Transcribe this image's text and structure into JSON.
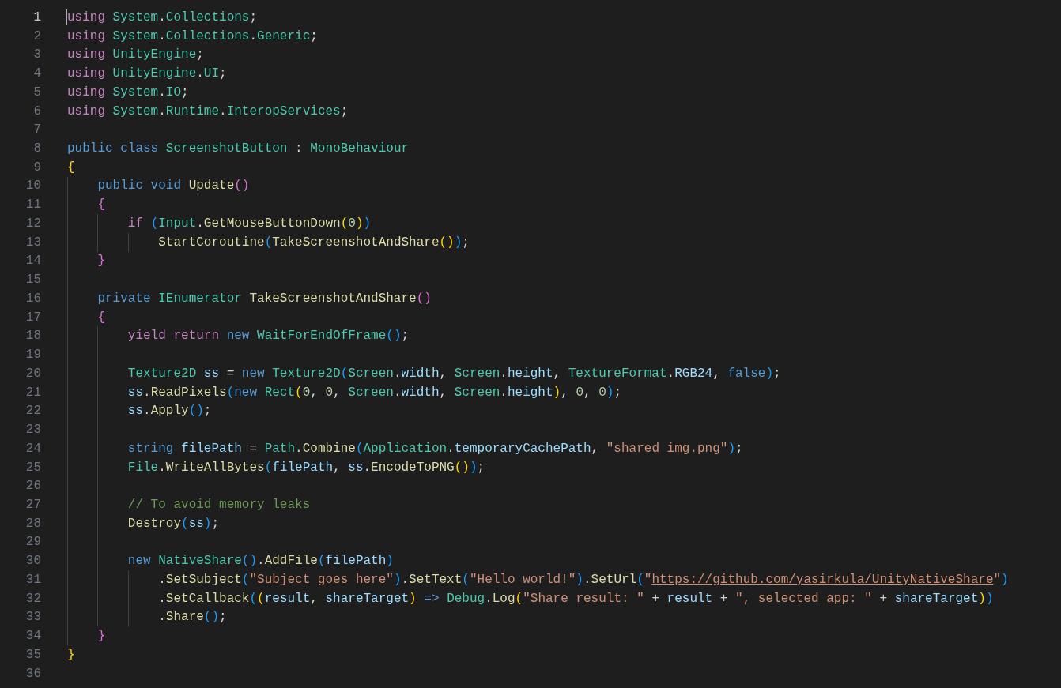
{
  "editor": {
    "lines": [
      {
        "number": "1",
        "active": true,
        "tokens": [
          {
            "kind": "ctl",
            "text": "using "
          },
          {
            "kind": "ty",
            "text": "System"
          },
          {
            "kind": "p",
            "text": "."
          },
          {
            "kind": "ty",
            "text": "Collections"
          },
          {
            "kind": "p",
            "text": ";"
          }
        ]
      },
      {
        "number": "2",
        "active": false,
        "tokens": [
          {
            "kind": "ctl",
            "text": "using "
          },
          {
            "kind": "ty",
            "text": "System"
          },
          {
            "kind": "p",
            "text": "."
          },
          {
            "kind": "ty",
            "text": "Collections"
          },
          {
            "kind": "p",
            "text": "."
          },
          {
            "kind": "ty",
            "text": "Generic"
          },
          {
            "kind": "p",
            "text": ";"
          }
        ]
      },
      {
        "number": "3",
        "active": false,
        "tokens": [
          {
            "kind": "ctl",
            "text": "using "
          },
          {
            "kind": "ty",
            "text": "UnityEngine"
          },
          {
            "kind": "p",
            "text": ";"
          }
        ]
      },
      {
        "number": "4",
        "active": false,
        "tokens": [
          {
            "kind": "ctl",
            "text": "using "
          },
          {
            "kind": "ty",
            "text": "UnityEngine"
          },
          {
            "kind": "p",
            "text": "."
          },
          {
            "kind": "ty",
            "text": "UI"
          },
          {
            "kind": "p",
            "text": ";"
          }
        ]
      },
      {
        "number": "5",
        "active": false,
        "tokens": [
          {
            "kind": "ctl",
            "text": "using "
          },
          {
            "kind": "ty",
            "text": "System"
          },
          {
            "kind": "p",
            "text": "."
          },
          {
            "kind": "ty",
            "text": "IO"
          },
          {
            "kind": "p",
            "text": ";"
          }
        ]
      },
      {
        "number": "6",
        "active": false,
        "tokens": [
          {
            "kind": "ctl",
            "text": "using "
          },
          {
            "kind": "ty",
            "text": "System"
          },
          {
            "kind": "p",
            "text": "."
          },
          {
            "kind": "ty",
            "text": "Runtime"
          },
          {
            "kind": "p",
            "text": "."
          },
          {
            "kind": "ty",
            "text": "InteropServices"
          },
          {
            "kind": "p",
            "text": ";"
          }
        ]
      },
      {
        "number": "7",
        "active": false
      },
      {
        "number": "8",
        "active": false,
        "tokens": [
          {
            "kind": "kw",
            "text": "public class "
          },
          {
            "kind": "ty",
            "text": "ScreenshotButton"
          },
          {
            "kind": "p",
            "text": " : "
          },
          {
            "kind": "ty",
            "text": "MonoBehaviour"
          }
        ]
      },
      {
        "number": "9",
        "active": false,
        "tokens": [
          {
            "kind": "b1",
            "text": "{"
          }
        ]
      },
      {
        "number": "10",
        "active": false,
        "tokens": [
          {
            "kind": "kw",
            "text": "    public void "
          },
          {
            "kind": "fn",
            "text": "Update"
          },
          {
            "kind": "b2",
            "text": "()"
          }
        ]
      },
      {
        "number": "11",
        "active": false,
        "tokens": [
          {
            "kind": "b2",
            "text": "    {"
          }
        ]
      },
      {
        "number": "12",
        "active": false,
        "tokens": [
          {
            "kind": "ctl",
            "text": "        if "
          },
          {
            "kind": "b3",
            "text": "("
          },
          {
            "kind": "ty",
            "text": "Input"
          },
          {
            "kind": "p",
            "text": "."
          },
          {
            "kind": "fn",
            "text": "GetMouseButtonDown"
          },
          {
            "kind": "b1",
            "text": "("
          },
          {
            "kind": "num",
            "text": "0"
          },
          {
            "kind": "b1",
            "text": ")"
          },
          {
            "kind": "b3",
            "text": ")"
          }
        ]
      },
      {
        "number": "13",
        "active": false,
        "tokens": [
          {
            "kind": "fn",
            "text": "            StartCoroutine"
          },
          {
            "kind": "b3",
            "text": "("
          },
          {
            "kind": "fn",
            "text": "TakeScreenshotAndShare"
          },
          {
            "kind": "b1",
            "text": "()"
          },
          {
            "kind": "b3",
            "text": ")"
          },
          {
            "kind": "p",
            "text": ";"
          }
        ]
      },
      {
        "number": "14",
        "active": false,
        "tokens": [
          {
            "kind": "b2",
            "text": "    }"
          }
        ]
      },
      {
        "number": "15",
        "active": false
      },
      {
        "number": "16",
        "active": false,
        "tokens": [
          {
            "kind": "kw",
            "text": "    private "
          },
          {
            "kind": "ty",
            "text": "IEnumerator "
          },
          {
            "kind": "fn",
            "text": "TakeScreenshotAndShare"
          },
          {
            "kind": "b2",
            "text": "()"
          }
        ]
      },
      {
        "number": "17",
        "active": false,
        "tokens": [
          {
            "kind": "b2",
            "text": "    {"
          }
        ]
      },
      {
        "number": "18",
        "active": false,
        "tokens": [
          {
            "kind": "ctl",
            "text": "        yield return "
          },
          {
            "kind": "kw",
            "text": "new "
          },
          {
            "kind": "ty",
            "text": "WaitForEndOfFrame"
          },
          {
            "kind": "b3",
            "text": "()"
          },
          {
            "kind": "p",
            "text": ";"
          }
        ]
      },
      {
        "number": "19",
        "active": false
      },
      {
        "number": "20",
        "active": false,
        "tokens": [
          {
            "kind": "ty",
            "text": "        Texture2D "
          },
          {
            "kind": "v",
            "text": "ss"
          },
          {
            "kind": "p",
            "text": " = "
          },
          {
            "kind": "kw",
            "text": "new "
          },
          {
            "kind": "ty",
            "text": "Texture2D"
          },
          {
            "kind": "b3",
            "text": "("
          },
          {
            "kind": "ty",
            "text": "Screen"
          },
          {
            "kind": "p",
            "text": "."
          },
          {
            "kind": "v",
            "text": "width"
          },
          {
            "kind": "p",
            "text": ", "
          },
          {
            "kind": "ty",
            "text": "Screen"
          },
          {
            "kind": "p",
            "text": "."
          },
          {
            "kind": "v",
            "text": "height"
          },
          {
            "kind": "p",
            "text": ", "
          },
          {
            "kind": "ty",
            "text": "TextureFormat"
          },
          {
            "kind": "p",
            "text": "."
          },
          {
            "kind": "v",
            "text": "RGB24"
          },
          {
            "kind": "p",
            "text": ", "
          },
          {
            "kind": "kw",
            "text": "false"
          },
          {
            "kind": "b3",
            "text": ")"
          },
          {
            "kind": "p",
            "text": ";"
          }
        ]
      },
      {
        "number": "21",
        "active": false,
        "tokens": [
          {
            "kind": "v",
            "text": "        ss"
          },
          {
            "kind": "p",
            "text": "."
          },
          {
            "kind": "fn",
            "text": "ReadPixels"
          },
          {
            "kind": "b3",
            "text": "("
          },
          {
            "kind": "kw",
            "text": "new "
          },
          {
            "kind": "ty",
            "text": "Rect"
          },
          {
            "kind": "b1",
            "text": "("
          },
          {
            "kind": "num",
            "text": "0"
          },
          {
            "kind": "p",
            "text": ", "
          },
          {
            "kind": "num",
            "text": "0"
          },
          {
            "kind": "p",
            "text": ", "
          },
          {
            "kind": "ty",
            "text": "Screen"
          },
          {
            "kind": "p",
            "text": "."
          },
          {
            "kind": "v",
            "text": "width"
          },
          {
            "kind": "p",
            "text": ", "
          },
          {
            "kind": "ty",
            "text": "Screen"
          },
          {
            "kind": "p",
            "text": "."
          },
          {
            "kind": "v",
            "text": "height"
          },
          {
            "kind": "b1",
            "text": ")"
          },
          {
            "kind": "p",
            "text": ", "
          },
          {
            "kind": "num",
            "text": "0"
          },
          {
            "kind": "p",
            "text": ", "
          },
          {
            "kind": "num",
            "text": "0"
          },
          {
            "kind": "b3",
            "text": ")"
          },
          {
            "kind": "p",
            "text": ";"
          }
        ]
      },
      {
        "number": "22",
        "active": false,
        "tokens": [
          {
            "kind": "v",
            "text": "        ss"
          },
          {
            "kind": "p",
            "text": "."
          },
          {
            "kind": "fn",
            "text": "Apply"
          },
          {
            "kind": "b3",
            "text": "()"
          },
          {
            "kind": "p",
            "text": ";"
          }
        ]
      },
      {
        "number": "23",
        "active": false
      },
      {
        "number": "24",
        "active": false,
        "tokens": [
          {
            "kind": "kw",
            "text": "        string "
          },
          {
            "kind": "v",
            "text": "filePath"
          },
          {
            "kind": "p",
            "text": " = "
          },
          {
            "kind": "ty",
            "text": "Path"
          },
          {
            "kind": "p",
            "text": "."
          },
          {
            "kind": "fn",
            "text": "Combine"
          },
          {
            "kind": "b3",
            "text": "("
          },
          {
            "kind": "ty",
            "text": "Application"
          },
          {
            "kind": "p",
            "text": "."
          },
          {
            "kind": "v",
            "text": "temporaryCachePath"
          },
          {
            "kind": "p",
            "text": ", "
          },
          {
            "kind": "str",
            "text": "\"shared img.png\""
          },
          {
            "kind": "b3",
            "text": ")"
          },
          {
            "kind": "p",
            "text": ";"
          }
        ]
      },
      {
        "number": "25",
        "active": false,
        "tokens": [
          {
            "kind": "ty",
            "text": "        File"
          },
          {
            "kind": "p",
            "text": "."
          },
          {
            "kind": "fn",
            "text": "WriteAllBytes"
          },
          {
            "kind": "b3",
            "text": "("
          },
          {
            "kind": "v",
            "text": "filePath"
          },
          {
            "kind": "p",
            "text": ", "
          },
          {
            "kind": "v",
            "text": "ss"
          },
          {
            "kind": "p",
            "text": "."
          },
          {
            "kind": "fn",
            "text": "EncodeToPNG"
          },
          {
            "kind": "b1",
            "text": "()"
          },
          {
            "kind": "b3",
            "text": ")"
          },
          {
            "kind": "p",
            "text": ";"
          }
        ]
      },
      {
        "number": "26",
        "active": false
      },
      {
        "number": "27",
        "active": false,
        "tokens": [
          {
            "kind": "cm",
            "text": "        // To avoid memory leaks"
          }
        ]
      },
      {
        "number": "28",
        "active": false,
        "tokens": [
          {
            "kind": "fn",
            "text": "        Destroy"
          },
          {
            "kind": "b3",
            "text": "("
          },
          {
            "kind": "v",
            "text": "ss"
          },
          {
            "kind": "b3",
            "text": ")"
          },
          {
            "kind": "p",
            "text": ";"
          }
        ]
      },
      {
        "number": "29",
        "active": false
      },
      {
        "number": "30",
        "active": false,
        "tokens": [
          {
            "kind": "kw",
            "text": "        new "
          },
          {
            "kind": "ty",
            "text": "NativeShare"
          },
          {
            "kind": "b3",
            "text": "()"
          },
          {
            "kind": "p",
            "text": "."
          },
          {
            "kind": "fn",
            "text": "AddFile"
          },
          {
            "kind": "b3",
            "text": "("
          },
          {
            "kind": "v",
            "text": "filePath"
          },
          {
            "kind": "b3",
            "text": ")"
          }
        ]
      },
      {
        "number": "31",
        "active": false,
        "tokens": [
          {
            "kind": "p",
            "text": "            ."
          },
          {
            "kind": "fn",
            "text": "SetSubject"
          },
          {
            "kind": "b3",
            "text": "("
          },
          {
            "kind": "str",
            "text": "\"Subject goes here\""
          },
          {
            "kind": "b3",
            "text": ")"
          },
          {
            "kind": "p",
            "text": "."
          },
          {
            "kind": "fn",
            "text": "SetText"
          },
          {
            "kind": "b3",
            "text": "("
          },
          {
            "kind": "str",
            "text": "\"Hello world!\""
          },
          {
            "kind": "b3",
            "text": ")"
          },
          {
            "kind": "p",
            "text": "."
          },
          {
            "kind": "fn",
            "text": "SetUrl"
          },
          {
            "kind": "b3",
            "text": "("
          },
          {
            "kind": "str",
            "text": "\""
          },
          {
            "kind": "link",
            "text": "https://github.com/yasirkula/UnityNativeShare"
          },
          {
            "kind": "str",
            "text": "\""
          },
          {
            "kind": "b3",
            "text": ")"
          }
        ]
      },
      {
        "number": "32",
        "active": false,
        "tokens": [
          {
            "kind": "p",
            "text": "            ."
          },
          {
            "kind": "fn",
            "text": "SetCallback"
          },
          {
            "kind": "b3",
            "text": "("
          },
          {
            "kind": "b1",
            "text": "("
          },
          {
            "kind": "v",
            "text": "result"
          },
          {
            "kind": "p",
            "text": ", "
          },
          {
            "kind": "v",
            "text": "shareTarget"
          },
          {
            "kind": "b1",
            "text": ")"
          },
          {
            "kind": "kw",
            "text": " => "
          },
          {
            "kind": "ty",
            "text": "Debug"
          },
          {
            "kind": "p",
            "text": "."
          },
          {
            "kind": "fn",
            "text": "Log"
          },
          {
            "kind": "b1",
            "text": "("
          },
          {
            "kind": "str",
            "text": "\"Share result: \""
          },
          {
            "kind": "p",
            "text": " + "
          },
          {
            "kind": "v",
            "text": "result"
          },
          {
            "kind": "p",
            "text": " + "
          },
          {
            "kind": "str",
            "text": "\", selected app: \""
          },
          {
            "kind": "p",
            "text": " + "
          },
          {
            "kind": "v",
            "text": "shareTarget"
          },
          {
            "kind": "b1",
            "text": ")"
          },
          {
            "kind": "b3",
            "text": ")"
          }
        ]
      },
      {
        "number": "33",
        "active": false,
        "tokens": [
          {
            "kind": "p",
            "text": "            ."
          },
          {
            "kind": "fn",
            "text": "Share"
          },
          {
            "kind": "b3",
            "text": "()"
          },
          {
            "kind": "p",
            "text": ";"
          }
        ]
      },
      {
        "number": "34",
        "active": false,
        "tokens": [
          {
            "kind": "b2",
            "text": "    }"
          }
        ]
      },
      {
        "number": "35",
        "active": false,
        "tokens": [
          {
            "kind": "b1",
            "text": "}"
          }
        ]
      },
      {
        "number": "36",
        "active": false
      }
    ]
  }
}
